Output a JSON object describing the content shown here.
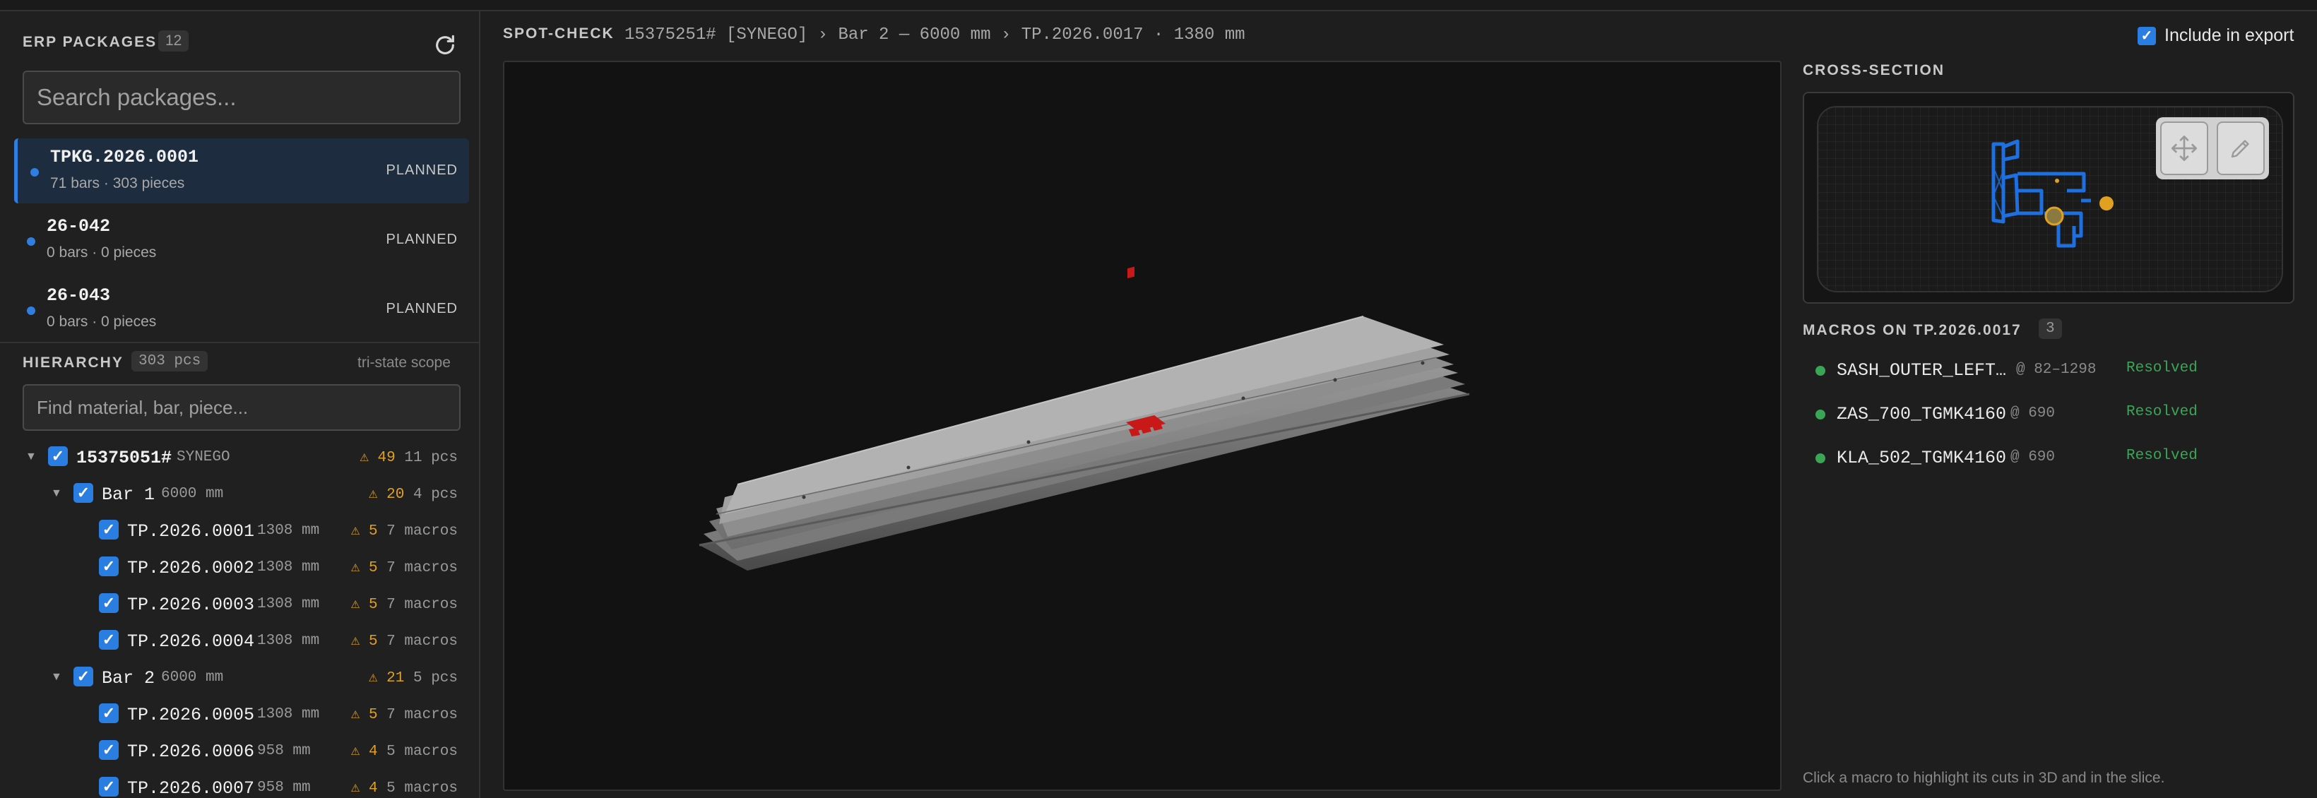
{
  "sidebar": {
    "erp_title": "ERP PACKAGES",
    "erp_count": "12",
    "search_placeholder": "Search packages...",
    "packages": [
      {
        "name": "TPKG.2026.0001",
        "meta": "71 bars · 303 pieces",
        "status": "PLANNED"
      },
      {
        "name": "26-042",
        "meta": "0 bars · 0 pieces",
        "status": "PLANNED"
      },
      {
        "name": "26-043",
        "meta": "0 bars · 0 pieces",
        "status": "PLANNED"
      }
    ],
    "hierarchy_title": "HIERARCHY",
    "hierarchy_count": "303 pcs",
    "scope_label": "tri-state scope",
    "find_placeholder": "Find material, bar, piece...",
    "tree": {
      "material": {
        "label": "15375051#",
        "sub": "SYNEGO",
        "warn": "⚠ 49",
        "count": "11 pcs"
      },
      "bars": [
        {
          "label": "Bar 1",
          "sub": "6000 mm",
          "warn": "⚠ 20",
          "count": "4 pcs",
          "pieces": [
            {
              "label": "TP.2026.0001",
              "sub": "1308 mm",
              "warn": "⚠ 5",
              "count": "7 macros"
            },
            {
              "label": "TP.2026.0002",
              "sub": "1308 mm",
              "warn": "⚠ 5",
              "count": "7 macros"
            },
            {
              "label": "TP.2026.0003",
              "sub": "1308 mm",
              "warn": "⚠ 5",
              "count": "7 macros"
            },
            {
              "label": "TP.2026.0004",
              "sub": "1308 mm",
              "warn": "⚠ 5",
              "count": "7 macros"
            }
          ]
        },
        {
          "label": "Bar 2",
          "sub": "6000 mm",
          "warn": "⚠ 21",
          "count": "5 pcs",
          "pieces": [
            {
              "label": "TP.2026.0005",
              "sub": "1308 mm",
              "warn": "⚠ 5",
              "count": "7 macros"
            },
            {
              "label": "TP.2026.0006",
              "sub": "958 mm",
              "warn": "⚠ 4",
              "count": "5 macros"
            },
            {
              "label": "TP.2026.0007",
              "sub": "958 mm",
              "warn": "⚠ 4",
              "count": "5 macros"
            }
          ]
        }
      ]
    }
  },
  "main": {
    "title": "SPOT-CHECK",
    "breadcrumb": "15375251# [SYNEGO] › Bar 2 — 6000 mm › TP.2026.0017 · 1380 mm",
    "export_label": "Include in export"
  },
  "right": {
    "cross_section_title": "CROSS-SECTION",
    "macros_title": "MACROS ON TP.2026.0017",
    "macros_count": "3",
    "macros": [
      {
        "name": "SASH_OUTER_LEFT…",
        "pos": "@ 82–1298",
        "status": "Resolved"
      },
      {
        "name": "ZAS_700_TGMK4160",
        "pos": "@ 690",
        "status": "Resolved"
      },
      {
        "name": "KLA_502_TGMK4160",
        "pos": "@ 690",
        "status": "Resolved"
      }
    ],
    "hint": "Click a macro to highlight its cuts in 3D and in the slice."
  },
  "colors": {
    "accent": "#2a7de1",
    "warn": "#e0a020",
    "ok": "#3aa655",
    "cut": "#c81818"
  },
  "icons": [
    "refresh-icon",
    "move-icon",
    "edit-icon",
    "chevron-down-icon",
    "checkbox-icon"
  ]
}
